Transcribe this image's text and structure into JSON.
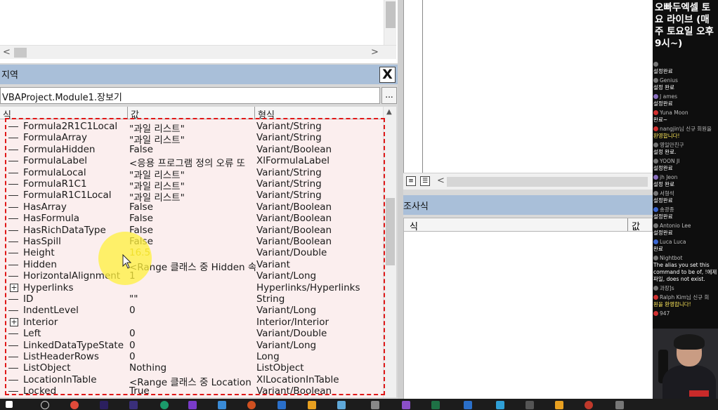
{
  "locals": {
    "title": "지역",
    "close_label": "X",
    "context": "VBAProject.Module1.장보기",
    "context_button": "...",
    "columns": {
      "expression": "식",
      "value": "값",
      "type": "형식"
    },
    "rows": [
      {
        "name": "Formula2R1C1Local",
        "value": "\"과일 리스트\"",
        "type": "Variant/String",
        "expandable": false
      },
      {
        "name": "FormulaArray",
        "value": "\"과일 리스트\"",
        "type": "Variant/String",
        "expandable": false
      },
      {
        "name": "FormulaHidden",
        "value": "False",
        "type": "Variant/Boolean",
        "expandable": false
      },
      {
        "name": "FormulaLabel",
        "value": "<응용 프로그램 정의 오류 또",
        "type": "XlFormulaLabel",
        "expandable": false
      },
      {
        "name": "FormulaLocal",
        "value": "\"과일 리스트\"",
        "type": "Variant/String",
        "expandable": false
      },
      {
        "name": "FormulaR1C1",
        "value": "\"과일 리스트\"",
        "type": "Variant/String",
        "expandable": false
      },
      {
        "name": "FormulaR1C1Local",
        "value": "\"과일 리스트\"",
        "type": "Variant/String",
        "expandable": false
      },
      {
        "name": "HasArray",
        "value": "False",
        "type": "Variant/Boolean",
        "expandable": false
      },
      {
        "name": "HasFormula",
        "value": "False",
        "type": "Variant/Boolean",
        "expandable": false
      },
      {
        "name": "HasRichDataType",
        "value": "False",
        "type": "Variant/Boolean",
        "expandable": false
      },
      {
        "name": "HasSpill",
        "value": "False",
        "type": "Variant/Boolean",
        "expandable": false
      },
      {
        "name": "Height",
        "value": "16.5",
        "type": "Variant/Double",
        "expandable": false
      },
      {
        "name": "Hidden",
        "value": "<Range 클래스 중 Hidden 속",
        "type": "Variant",
        "expandable": false
      },
      {
        "name": "HorizontalAlignment",
        "value": "1",
        "type": "Variant/Long",
        "expandable": false
      },
      {
        "name": "Hyperlinks",
        "value": "",
        "type": "Hyperlinks/Hyperlinks",
        "expandable": true
      },
      {
        "name": "ID",
        "value": "\"\"",
        "type": "String",
        "expandable": false
      },
      {
        "name": "IndentLevel",
        "value": "0",
        "type": "Variant/Long",
        "expandable": false
      },
      {
        "name": "Interior",
        "value": "",
        "type": "Interior/Interior",
        "expandable": true
      },
      {
        "name": "Left",
        "value": "0",
        "type": "Variant/Double",
        "expandable": false
      },
      {
        "name": "LinkedDataTypeState",
        "value": "0",
        "type": "Variant/Long",
        "expandable": false
      },
      {
        "name": "ListHeaderRows",
        "value": "0",
        "type": "Long",
        "expandable": false
      },
      {
        "name": "ListObject",
        "value": "Nothing",
        "type": "ListObject",
        "expandable": false
      },
      {
        "name": "LocationInTable",
        "value": "<Range 클래스 중 Location",
        "type": "XlLocationInTable",
        "expandable": false
      },
      {
        "name": "Locked",
        "value": "True",
        "type": "Variant/Boolean",
        "expandable": false
      }
    ]
  },
  "watch": {
    "title": "조사식",
    "columns": {
      "expression": "식",
      "value": "값"
    }
  },
  "stream": {
    "title": "오빠두엑셀 토요 라이브 (매주 토요일 오후 9시~)",
    "chat": [
      {
        "user": "",
        "text": "설정완료",
        "avatar": "gray"
      },
      {
        "user": "Genius",
        "text": "설정 완료",
        "avatar": "gray"
      },
      {
        "user": "J ames",
        "text": "설정완료",
        "avatar": "purple"
      },
      {
        "user": "Yuna Moon",
        "text": "완료~",
        "avatar": "red"
      },
      {
        "user": "nangjin님 신규 회원을",
        "text": "환영합니다!",
        "avatar": "red",
        "highlight": true
      },
      {
        "user": "영일만친구",
        "text": "설정 완료.",
        "avatar": "gray"
      },
      {
        "user": "YOON JI",
        "text": "설정완료",
        "avatar": "gray"
      },
      {
        "user": "jh Jeon",
        "text": "설정 완료",
        "avatar": "purple"
      },
      {
        "user": "서형석",
        "text": "설정완료",
        "avatar": "gray"
      },
      {
        "user": "송광종",
        "text": "설정완료",
        "avatar": "blue"
      },
      {
        "user": "Antonio Lee",
        "text": "설정완료",
        "avatar": "gray"
      },
      {
        "user": "Luca Luca",
        "text": "완료",
        "avatar": "blue"
      },
      {
        "user": "Nightbot",
        "text": "The alias you set this command to be of, !에제파일, does not exist.",
        "avatar": "gray"
      },
      {
        "user": "과장]s",
        "text": "",
        "avatar": "gray"
      },
      {
        "user": "Ralph Kim님 신규 회",
        "text": "원을 환영합니다!",
        "avatar": "red",
        "highlight": true
      },
      {
        "user": "947",
        "text": "",
        "avatar": "red"
      }
    ]
  },
  "colors": {
    "title_bar": "#a9bfd9",
    "highlight_border": "#e01818",
    "list_bg": "#fbeeee",
    "cursor_glow": "#fff03c"
  }
}
